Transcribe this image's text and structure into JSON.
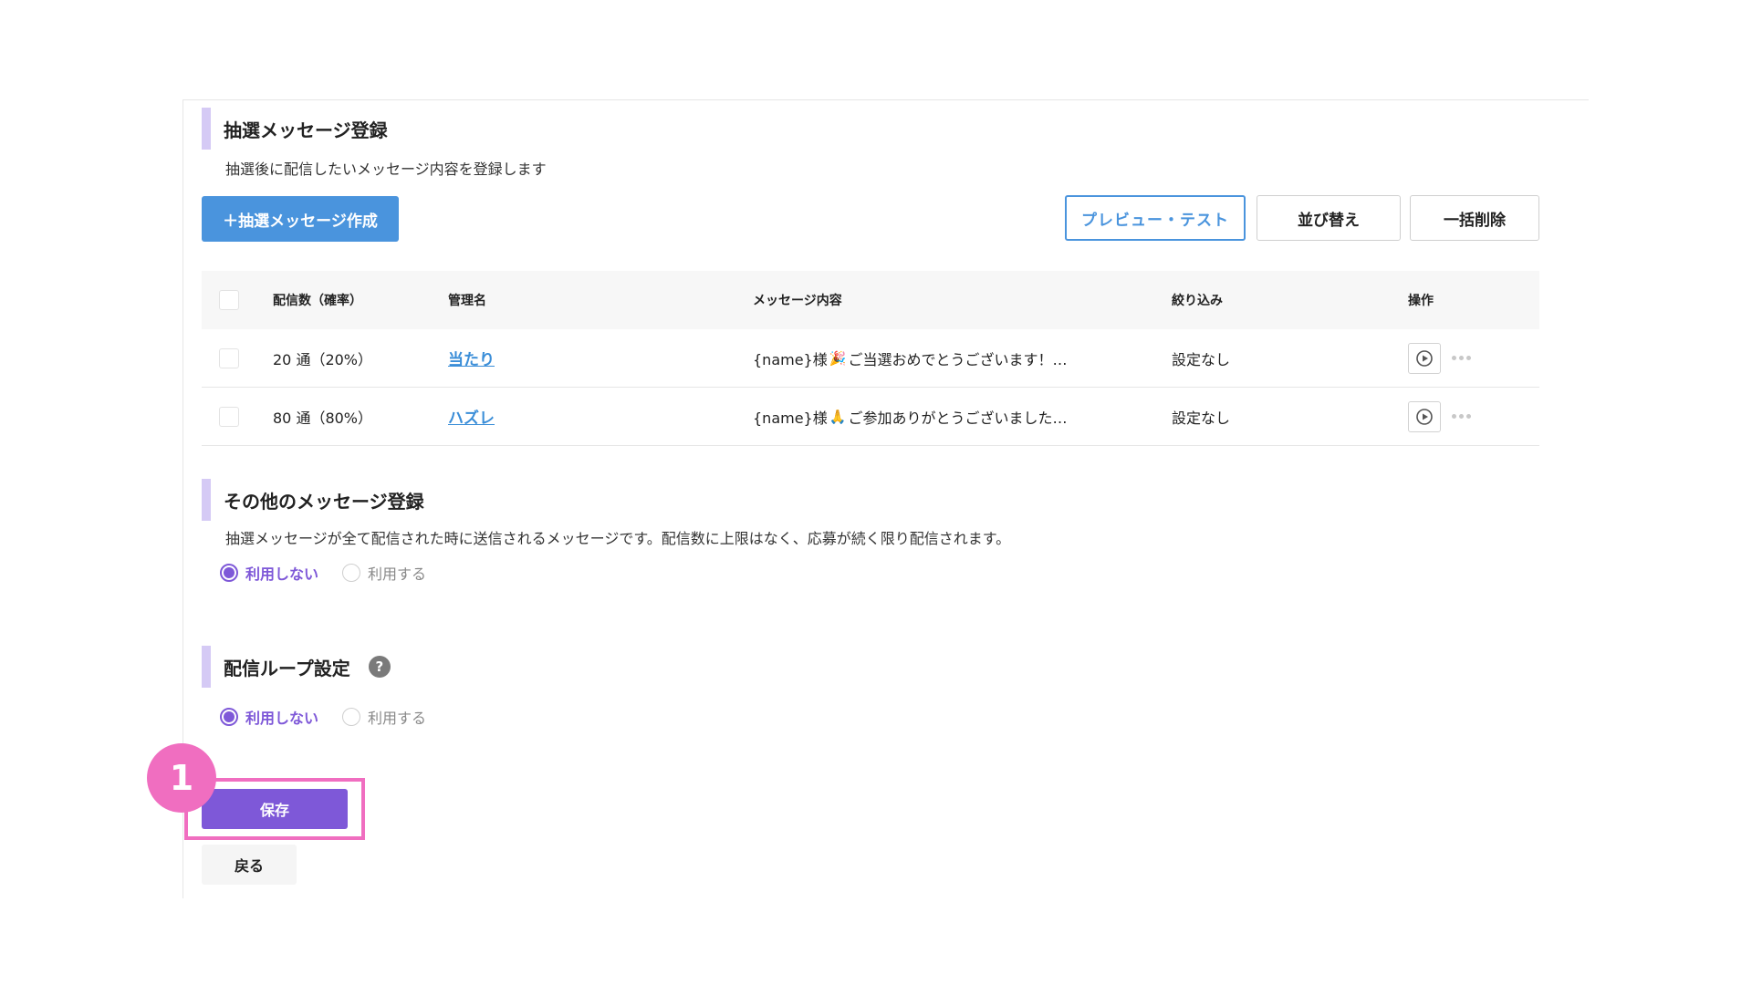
{
  "lottery": {
    "title": "抽選メッセージ登録",
    "description": "抽選後に配信したいメッセージ内容を登録します",
    "create_button": "＋抽選メッセージ作成",
    "preview_button": "プレビュー・テスト",
    "sort_button": "並び替え",
    "bulk_delete_button": "一括削除",
    "table": {
      "headers": {
        "count": "配信数（確率）",
        "name": "管理名",
        "content": "メッセージ内容",
        "filter": "絞り込み",
        "ops": "操作"
      },
      "rows": [
        {
          "count": "20 通（20%）",
          "name": "当たり",
          "content_prefix": "{name}様",
          "content_emoji": "🎉",
          "content_text": "ご当選おめでとうございます！…",
          "filter": "設定なし"
        },
        {
          "count": "80 通（80%）",
          "name": "ハズレ",
          "content_prefix": "{name}様",
          "content_emoji": "🙏",
          "content_text": "ご参加ありがとうございました…",
          "filter": "設定なし"
        }
      ]
    }
  },
  "other_messages": {
    "title": "その他のメッセージ登録",
    "description": "抽選メッセージが全て配信された時に送信されるメッセージです。配信数に上限はなく、応募が続く限り配信されます。",
    "options": {
      "off": "利用しない",
      "on": "利用する"
    },
    "selected": "off"
  },
  "loop_setting": {
    "title": "配信ループ設定",
    "help": "?",
    "options": {
      "off": "利用しない",
      "on": "利用する"
    },
    "selected": "off"
  },
  "footer": {
    "save_button": "保存",
    "back_button": "戻る",
    "step_number": "1"
  },
  "colors": {
    "accent_purple": "#7e58d8",
    "accent_blue": "#4a94dd",
    "highlight_pink": "#f06ec0",
    "section_bar": "#d5caf5"
  },
  "icons": {
    "play": "play-circle-icon",
    "more": "more-horizontal-icon",
    "help": "help-circle-icon"
  }
}
